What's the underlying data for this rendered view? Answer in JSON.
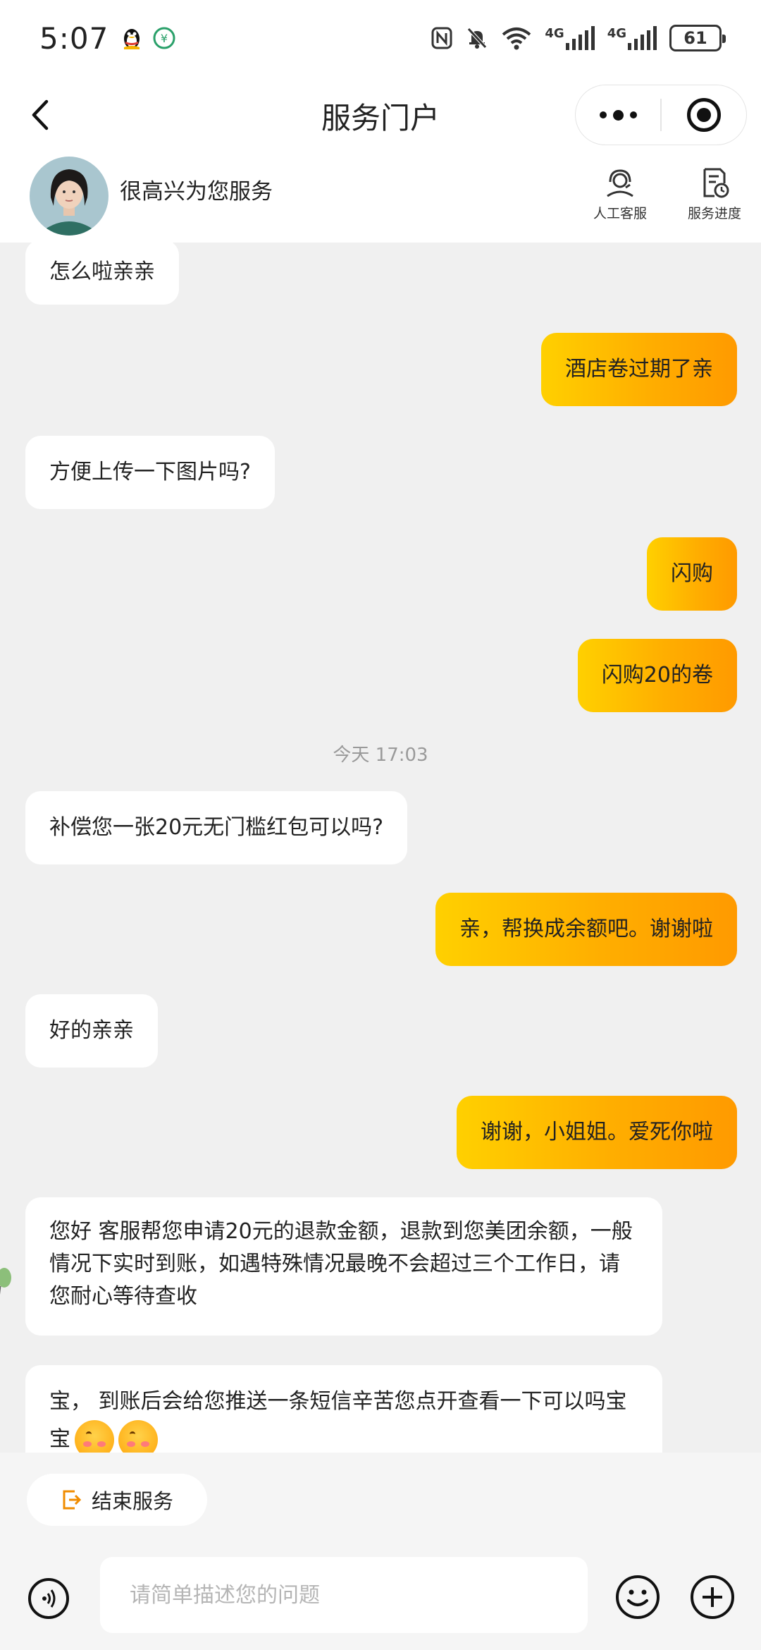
{
  "status_bar": {
    "time": "5:07",
    "battery": "61",
    "network_1": "4G",
    "network_2": "4G"
  },
  "nav": {
    "title": "服务门户"
  },
  "service": {
    "greeting": "很高兴为您服务",
    "actions": [
      {
        "label": "人工客服",
        "icon": "agent-icon"
      },
      {
        "label": "服务进度",
        "icon": "progress-doc-icon"
      }
    ]
  },
  "chat": {
    "messages": [
      {
        "from": "agent",
        "text": "怎么啦亲亲"
      },
      {
        "from": "user",
        "text": "酒店卷过期了亲"
      },
      {
        "from": "agent",
        "text": "方便上传一下图片吗?"
      },
      {
        "from": "user",
        "text": "闪购"
      },
      {
        "from": "user",
        "text": "闪购20的卷"
      },
      {
        "from": "agent",
        "text": "补偿您一张20元无门槛红包可以吗?"
      },
      {
        "from": "user",
        "text": "亲，帮换成余额吧。谢谢啦"
      },
      {
        "from": "agent",
        "text": "好的亲亲"
      },
      {
        "from": "user",
        "text": "谢谢，小姐姐。爱死你啦"
      },
      {
        "from": "agent",
        "text": "您好 客服帮您申请20元的退款金额，退款到您美团余额，一般情况下实时到账，如遇特殊情况最晚不会超过三个工作日，请您耐心等待查收"
      },
      {
        "from": "agent",
        "text": "宝， 到账后会给您推送一条短信辛苦您点开查看一下可以吗宝宝"
      }
    ],
    "time_label": "今天 17:03"
  },
  "bottom": {
    "end_service_label": "结束服务",
    "input_placeholder": "请简单描述您的问题"
  },
  "colors": {
    "user_bubble_start": "#ffd000",
    "user_bubble_end": "#ff9a00",
    "accent_orange": "#f08c00",
    "chat_bg": "#f0f0f0"
  }
}
